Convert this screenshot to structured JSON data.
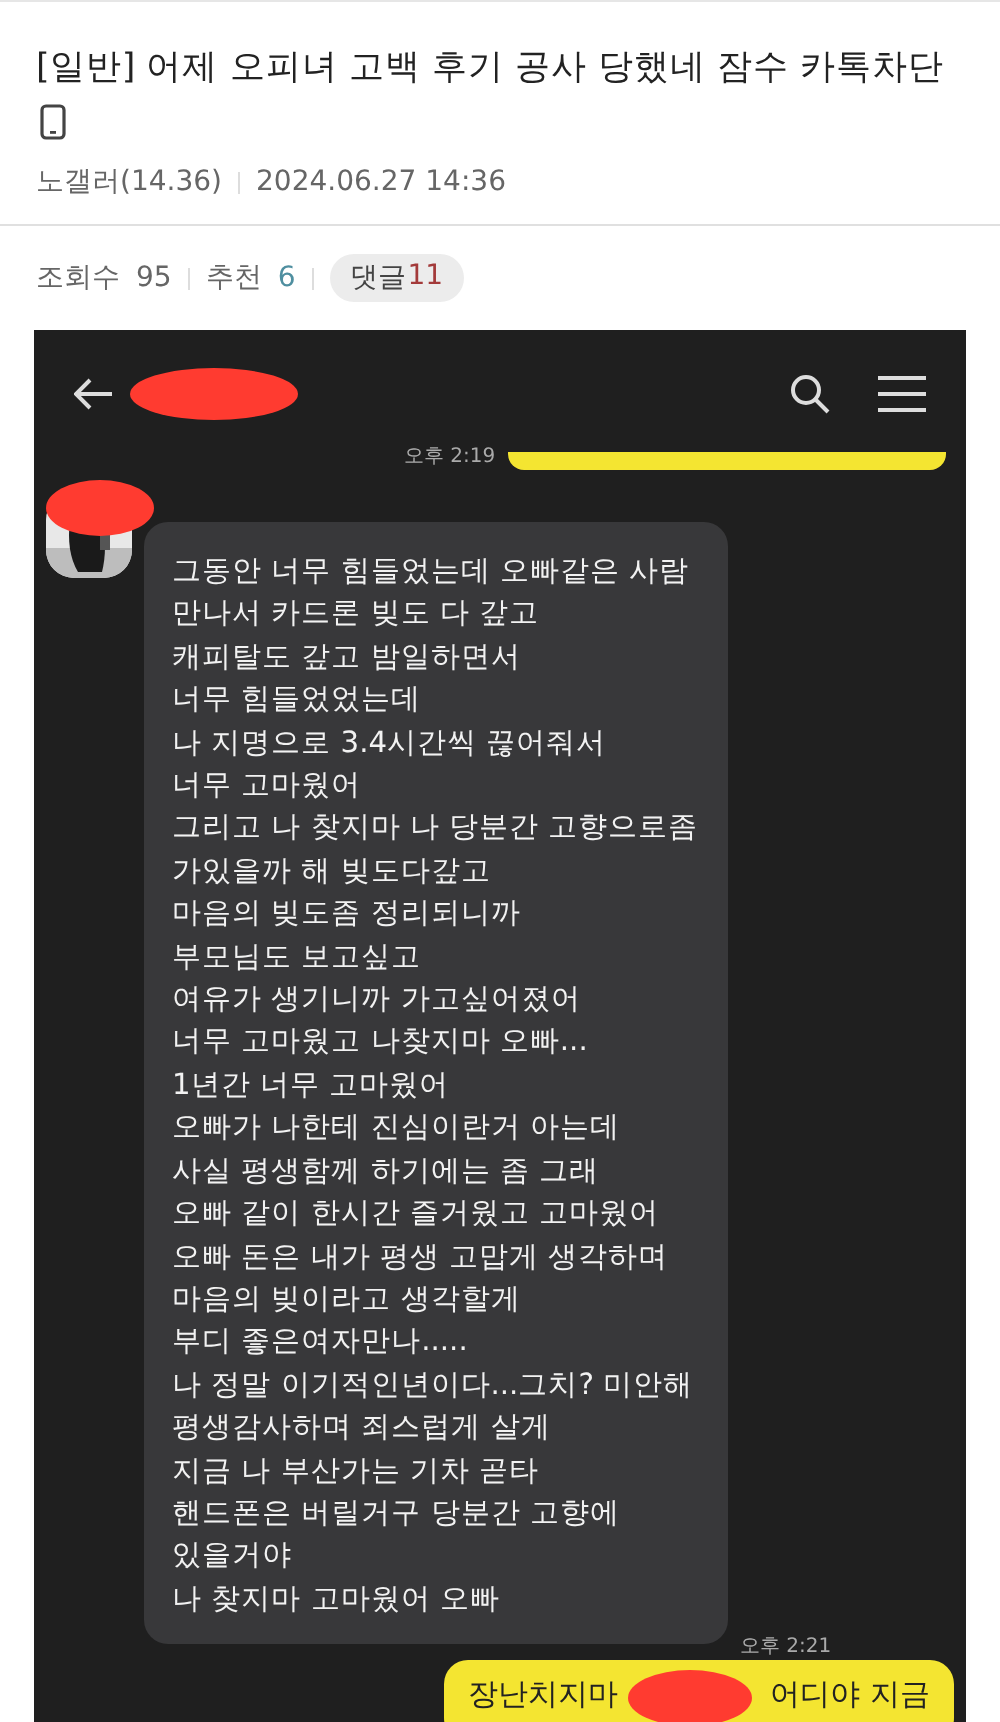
{
  "post": {
    "title": "[일반] 어제 오피녀 고백 후기 공사 당했네 잠수 카톡차단",
    "author": "노갤러(14.36)",
    "date": "2024.06.27 14:36"
  },
  "stats": {
    "views_label": "조회수",
    "views": "95",
    "likes_label": "추천",
    "likes": "6",
    "comments_label": "댓글",
    "comments": "11"
  },
  "chat": {
    "messages": [
      {
        "kind": "sent_cut",
        "time": "오후 2:19"
      },
      {
        "kind": "received",
        "text": "그동안 너무 힘들었는데 오빠같은 사람\n만나서 카드론 빚도 다 갚고\n캐피탈도 갚고 밤일하면서\n너무 힘들었었는데\n나 지명으로 3.4시간씩 끊어줘서\n너무 고마웠어\n그리고  나 찾지마 나 당분간 고향으로좀\n가있을까 해 빚도다갚고\n마음의 빚도좀 정리되니까\n부모님도 보고싶고\n여유가 생기니까 가고싶어졌어\n너무 고마웠고 나찾지마 오빠...\n1년간 너무 고마웠어\n오빠가 나한테 진심이란거 아는데\n사실 평생함께 하기에는 좀 그래\n오빠 같이 한시간 즐거웠고 고마웠어\n오빠 돈은 내가 평생 고맙게 생각하며\n마음의 빚이라고 생각할게\n부디 좋은여자만나.....\n나 정말 이기적인년이다...그치? 미안해\n평생감사하며 죄스럽게 살게\n지금 나 부산가는 기차 곧타\n핸드폰은 버릴거구 당분간 고향에\n있을거야\n나 찾지마 고마웠어 오빠",
        "time": "오후 2:21"
      },
      {
        "kind": "sent",
        "text_before": "장난치지마",
        "text_after": "어디야 지금"
      }
    ]
  }
}
